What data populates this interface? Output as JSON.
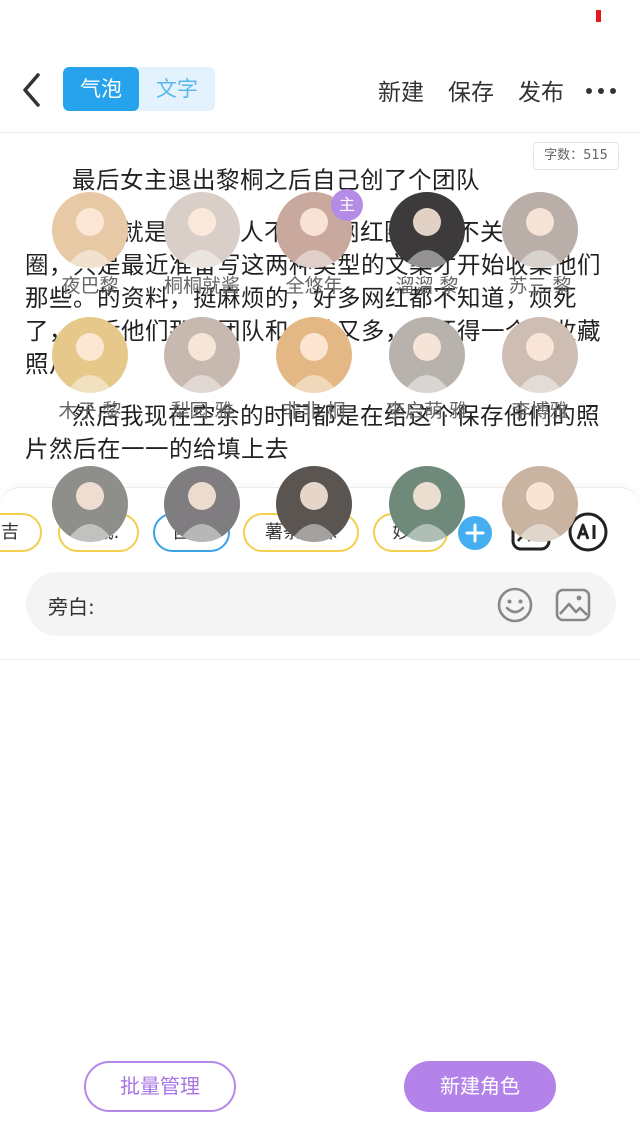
{
  "header": {
    "tabs": [
      {
        "label": "气泡",
        "active": true
      },
      {
        "label": "文字",
        "active": false
      }
    ],
    "actions": [
      "新建",
      "保存",
      "发布"
    ]
  },
  "word_count": "字数：515",
  "document": {
    "paragraphs": [
      "最后女主退出黎桐之后自己创了个团队",
      "然后就是我这个人不关注网红圈，也不关注娱乐圈，只是最近准备写这两种类型的文案才开始收集他们那些。的资料，挺麻烦的，好多网红都不知道，烦死了，然后他们那些团队和人数又多，我还得一个个收藏照片",
      "然后我现在空余的时间都是在给这个保存他们的照片然后在一一的给填上去"
    ]
  },
  "role_chips": [
    "吉",
    "王威.",
    "困困",
    "薯条妹妹",
    "妙妙"
  ],
  "input": {
    "label": "旁白:"
  },
  "characters": [
    {
      "name": "夜巴黎",
      "color": "#e8c9a6"
    },
    {
      "name": "桐桐就酱",
      "color": "#d9cfc8"
    },
    {
      "name": "全悠年",
      "color": "#c9a89e",
      "badge": "主"
    },
    {
      "name": "溜溜.黎",
      "color": "#3c3a3a"
    },
    {
      "name": "苏三.黎",
      "color": "#b9aea8"
    },
    {
      "name": "木子.黎",
      "color": "#e6c98a"
    },
    {
      "name": "梨园.雅",
      "color": "#c8b9b0"
    },
    {
      "name": "非非.桐",
      "color": "#e4b884"
    },
    {
      "name": "李启萌.雅",
      "color": "#b8b2ad"
    },
    {
      "name": "李博雅",
      "color": "#cdbdb2"
    },
    {
      "name": "",
      "color": "#8e8f8a"
    },
    {
      "name": "",
      "color": "#7f7d7f"
    },
    {
      "name": "",
      "color": "#5a5550"
    },
    {
      "name": "",
      "color": "#6f8a7a"
    },
    {
      "name": "",
      "color": "#c8b4a0"
    }
  ],
  "buttons": {
    "manage": "批量管理",
    "new_role": "新建角色"
  },
  "colors": {
    "accent_blue": "#27a3ee",
    "accent_purple": "#b383ea",
    "chip_yellow": "#f2cf4c"
  }
}
